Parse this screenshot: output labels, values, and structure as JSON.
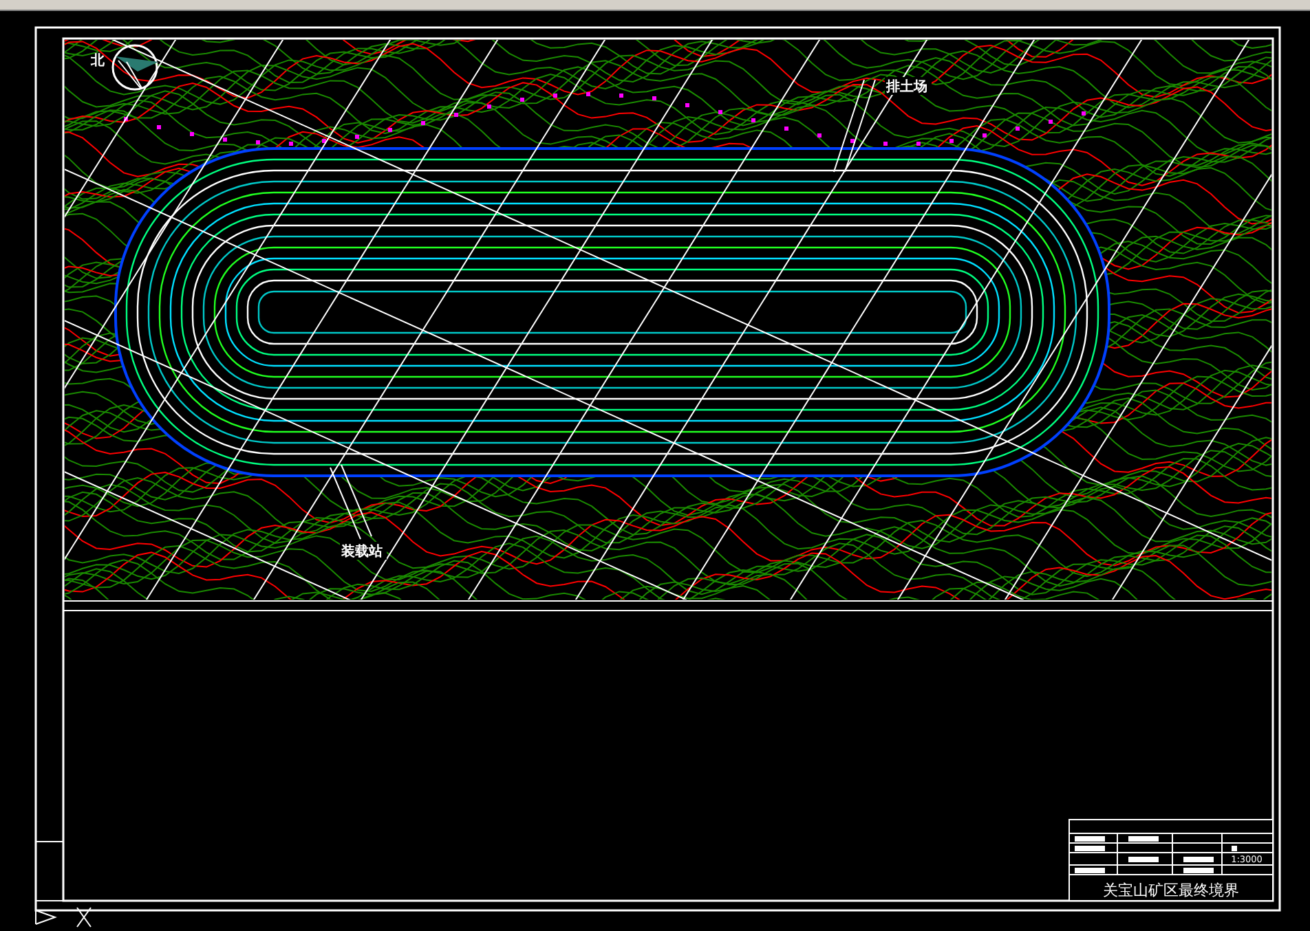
{
  "drawing": {
    "north_label": "北",
    "labels": [
      {
        "text": "排土场",
        "kind": "dump"
      },
      {
        "text": "装载站",
        "kind": "loading"
      }
    ],
    "title_block": {
      "scale": "1:3000",
      "title": "关宝山矿区最终境界"
    }
  }
}
